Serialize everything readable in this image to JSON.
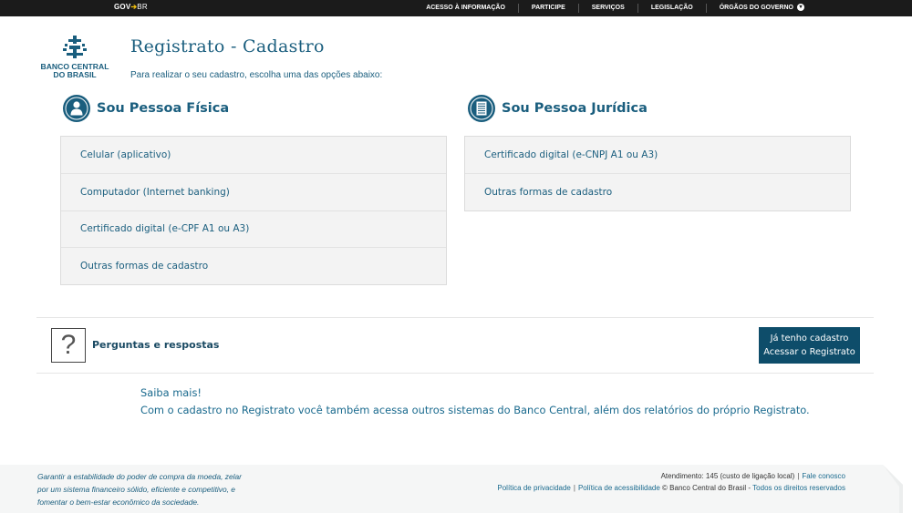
{
  "govbar": {
    "logo_gov": "GOV",
    "logo_br": "BR",
    "nav": [
      "ACESSO À INFORMAÇÃO",
      "PARTICIPE",
      "SERVIÇOS",
      "LEGISLAÇÃO",
      "ÓRGÃOS DO GOVERNO"
    ]
  },
  "header": {
    "logo_line1": "BANCO CENTRAL",
    "logo_line2": "DO BRASIL",
    "title": "Registrato - Cadastro",
    "subtitle": "Para realizar o seu cadastro, escolha uma das opções abaixo:"
  },
  "pessoa_fisica": {
    "title": "Sou Pessoa Física",
    "options": [
      "Celular (aplicativo)",
      "Computador (Internet banking)",
      "Certificado digital (e-CPF A1 ou A3)",
      "Outras formas de cadastro"
    ]
  },
  "pessoa_juridica": {
    "title": "Sou Pessoa Jurídica",
    "options": [
      "Certificado digital (e-CNPJ A1 ou A3)",
      "Outras formas de cadastro"
    ]
  },
  "faq": {
    "icon_glyph": "?",
    "label": "Perguntas e respostas"
  },
  "login_button": {
    "line1": "Já tenho cadastro",
    "line2": "Acessar o Registrato"
  },
  "saiba": {
    "line1": "Saiba mais!",
    "line2": "Com o cadastro no Registrato você também acessa outros sistemas do Banco Central, além dos relatórios do próprio Registrato."
  },
  "footer": {
    "mission_line1": "Garantir a estabilidade do poder de compra da moeda, zelar",
    "mission_line2": "por um sistema financeiro sólido, eficiente e competitivo, e",
    "mission_line3": "fomentar o bem-estar econômico da sociedade.",
    "atendimento": "Atendimento: 145 (custo de ligação local)",
    "fale_conosco": "Fale conosco",
    "privacidade": "Política de privacidade",
    "acessibilidade": "Política de acessibilidade",
    "copyright": "© Banco Central do Brasil -",
    "direitos": "Todos os direitos reservados"
  },
  "colors": {
    "brand": "#1a5e7e",
    "button": "#0e4d6a",
    "govbar": "#1b1b1b"
  }
}
